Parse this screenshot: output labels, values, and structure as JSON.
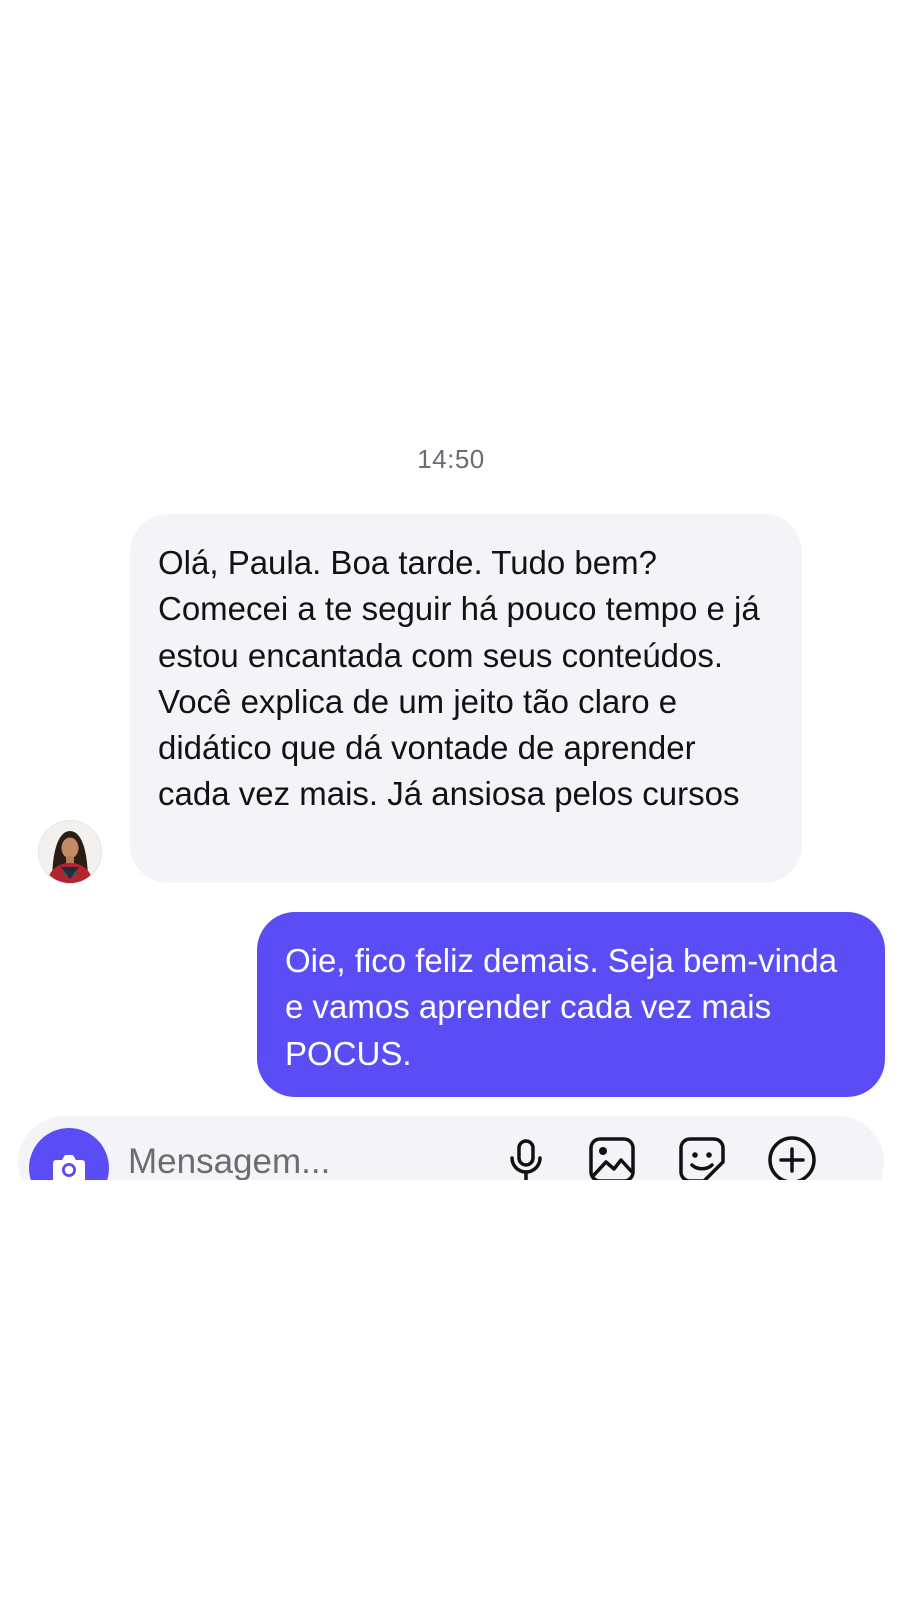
{
  "conversation": {
    "timestamp": "14:50",
    "messages": [
      {
        "direction": "incoming",
        "text": "Olá, Paula. Boa tarde. Tudo bem? Comecei a te seguir há pouco tempo e já estou encantada com seus conteúdos. Você explica de um jeito tão claro e didático que dá vontade de aprender cada vez mais. Já ansiosa pelos cursos"
      },
      {
        "direction": "outgoing",
        "text": "Oie, fico feliz demais. Seja bem-vinda e vamos aprender cada vez mais POCUS."
      }
    ]
  },
  "composer": {
    "placeholder": "Mensagem...",
    "icons": [
      "camera-icon",
      "microphone-icon",
      "gallery-icon",
      "sticker-icon",
      "plus-circle-icon"
    ]
  },
  "colors": {
    "accent": "#5b4df5",
    "incoming_bubble": "#f4f4f8",
    "timestamp_text": "#6b6b73"
  }
}
